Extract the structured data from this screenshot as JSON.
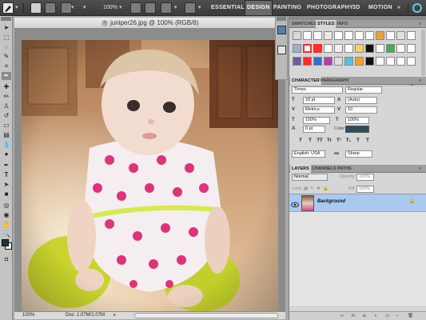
{
  "topbar": {
    "zoom": "100%",
    "workspaces": {
      "essentials": "ESSENTIALS",
      "design": "DESIGN",
      "painting": "PAINTING",
      "photography": "PHOTOGRAPHY",
      "three_d": "3D",
      "motion": "MOTION"
    },
    "more": "»"
  },
  "document": {
    "title": "juniper26.jpg @ 100% (RGB/8)",
    "status_zoom": "100%",
    "status_doc": "Doc: 1.07M/1.07M"
  },
  "tool_colors": {
    "foreground": "#1f3540",
    "background": "#ffffff"
  },
  "styles_panel": {
    "tabs": [
      "SWATCHES",
      "STYLES",
      "INFO"
    ],
    "active_tab": "STYLES",
    "swatch_colors": [
      "#fafafa",
      "#ff2a2a",
      "#6e99d6",
      "#111111",
      "#3bb24a",
      "#e0a03a",
      "#b33cb3",
      "#57c1d9"
    ]
  },
  "character_panel": {
    "tabs": [
      "CHARACTER",
      "PARAGRAPH"
    ],
    "active_tab": "CHARACTER",
    "font_family": "Times",
    "font_style": "Regular",
    "font_size": "18 pt",
    "leading": "(Auto)",
    "kerning": "Metrics",
    "tracking": "10",
    "vertical_scale": "100%",
    "horizontal_scale": "100%",
    "baseline_shift": "0 pt",
    "color_label": "Color:",
    "color": "#2e4b5a",
    "type_styles": [
      "T",
      "T",
      "TT",
      "Tr",
      "T¹",
      "T₁",
      "T",
      "T"
    ],
    "language": "English: USA",
    "anti_alias_icon": "aa",
    "anti_alias": "Sharp"
  },
  "layers_panel": {
    "tabs": [
      "LAYERS",
      "CHANNELS",
      "PATHS"
    ],
    "active_tab": "LAYERS",
    "blend_mode": "Normal",
    "opacity_label": "Opacity:",
    "opacity": "100%",
    "lock_label": "Lock:",
    "fill_label": "Fill:",
    "fill": "100%",
    "layers": [
      {
        "name": "Background",
        "visible": true,
        "locked": true,
        "selected": true
      }
    ]
  }
}
